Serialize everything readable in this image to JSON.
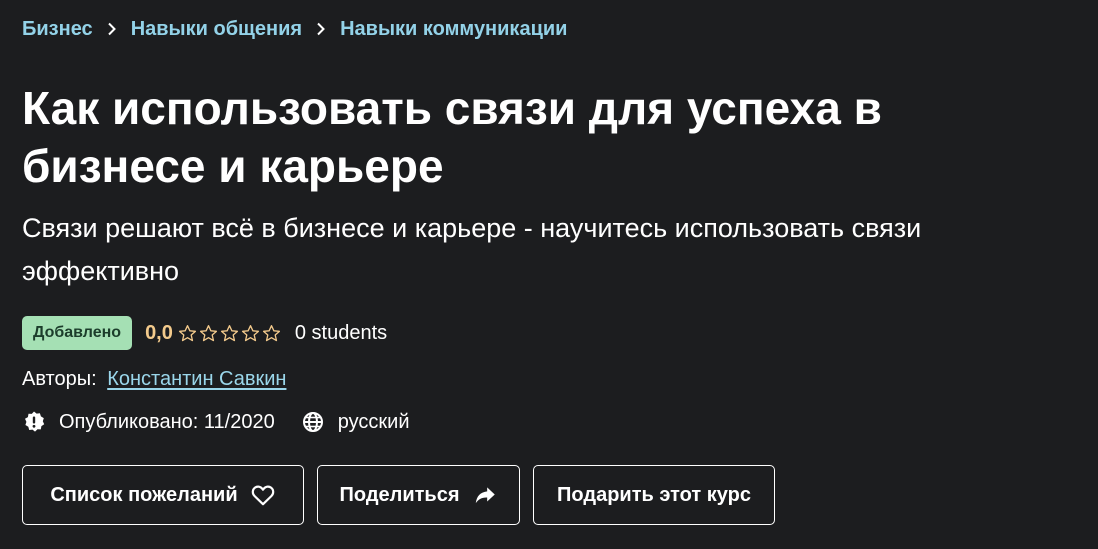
{
  "breadcrumb": {
    "items": [
      "Бизнес",
      "Навыки общения",
      "Навыки коммуникации"
    ]
  },
  "course": {
    "title": "Как использовать связи для успеха в бизнесе и карьере",
    "subtitle": "Связи решают всё в бизнесе и карьере - научитесь использовать связи эффективно"
  },
  "rating": {
    "badge": "Добавлено",
    "value": "0,0",
    "stars_filled": 0,
    "stars_total": 5,
    "students": "0 students"
  },
  "authors": {
    "label": "Авторы:",
    "name": "Константин Савкин"
  },
  "meta": {
    "published": "Опубликовано: 11/2020",
    "language": "русский"
  },
  "actions": {
    "wishlist": "Список пожеланий",
    "share": "Поделиться",
    "gift": "Подарить этот курс"
  },
  "colors": {
    "background": "#1c1d1f",
    "link": "#9ad6ea",
    "rating": "#f3ca8c",
    "badge_bg": "#a5e0b4"
  }
}
